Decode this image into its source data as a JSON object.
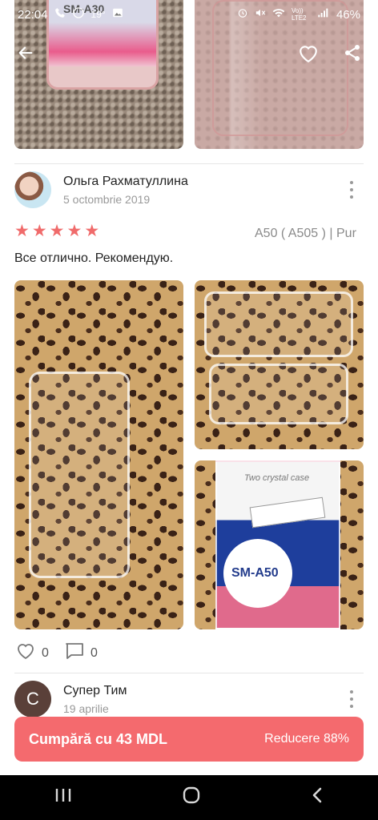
{
  "status_bar": {
    "time": "22:04",
    "temperature": "19°",
    "network": "Vo)) LTE2",
    "battery": "46%"
  },
  "top_photos": {
    "left_label": "SM-A30"
  },
  "icons": {
    "back": "arrow-left-icon",
    "favorite": "heart-outline-icon",
    "share": "share-icon",
    "like": "heart-outline-icon",
    "comment": "comment-icon",
    "menu": "more-vertical-icon"
  },
  "review": {
    "reviewer_name": "Ольга Рахматуллина",
    "date": "5 octombrie 2019",
    "rating": 5,
    "variant": "A50 ( A505 ) | Pur",
    "text": "Все отлично. Рекомендую.",
    "likes": "0",
    "comments": "0",
    "photo_labels": {
      "box_text": "Two crystal case",
      "model": "SM-A50"
    }
  },
  "next_review": {
    "avatar_letter": "C",
    "reviewer_name": "Супер Тим",
    "date": "19 aprilie"
  },
  "buy_bar": {
    "label": "Cumpără cu 43 MDL",
    "discount": "Reducere 88%"
  },
  "colors": {
    "accent": "#f46a6e",
    "star": "#f06b6b"
  }
}
